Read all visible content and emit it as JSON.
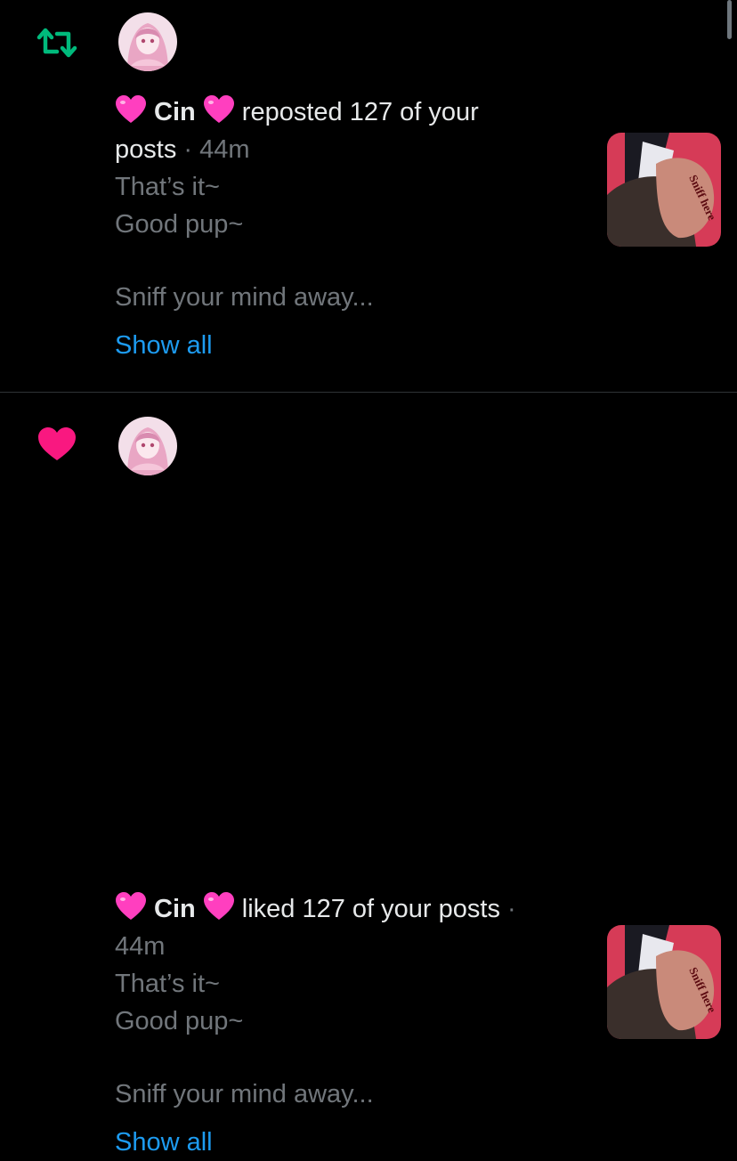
{
  "notifications": [
    {
      "type": "repost",
      "icon": "repost-icon",
      "user": "Cin",
      "action_line1": "reposted 127 of your",
      "action_line2": "posts",
      "separator": "·",
      "time": "44m",
      "snippet": [
        "That’s it~",
        "Good pup~",
        "Sniff your mind away..."
      ],
      "show_all": "Show all",
      "thumbnail_text": "Sniff here"
    },
    {
      "type": "like",
      "icon": "heart-icon",
      "user": "Cin",
      "action_line1": "liked 127 of your posts",
      "separator": "·",
      "time": "44m",
      "snippet": [
        "That’s it~",
        "Good pup~",
        "Sniff your mind away..."
      ],
      "show_all": "Show all",
      "thumbnail_text": "Sniff here"
    }
  ],
  "colors": {
    "background": "#000000",
    "text": "#e7e9ea",
    "muted": "#71767b",
    "link": "#1d9bf0",
    "repost_green": "#00ba7c",
    "like_pink": "#f91880"
  }
}
